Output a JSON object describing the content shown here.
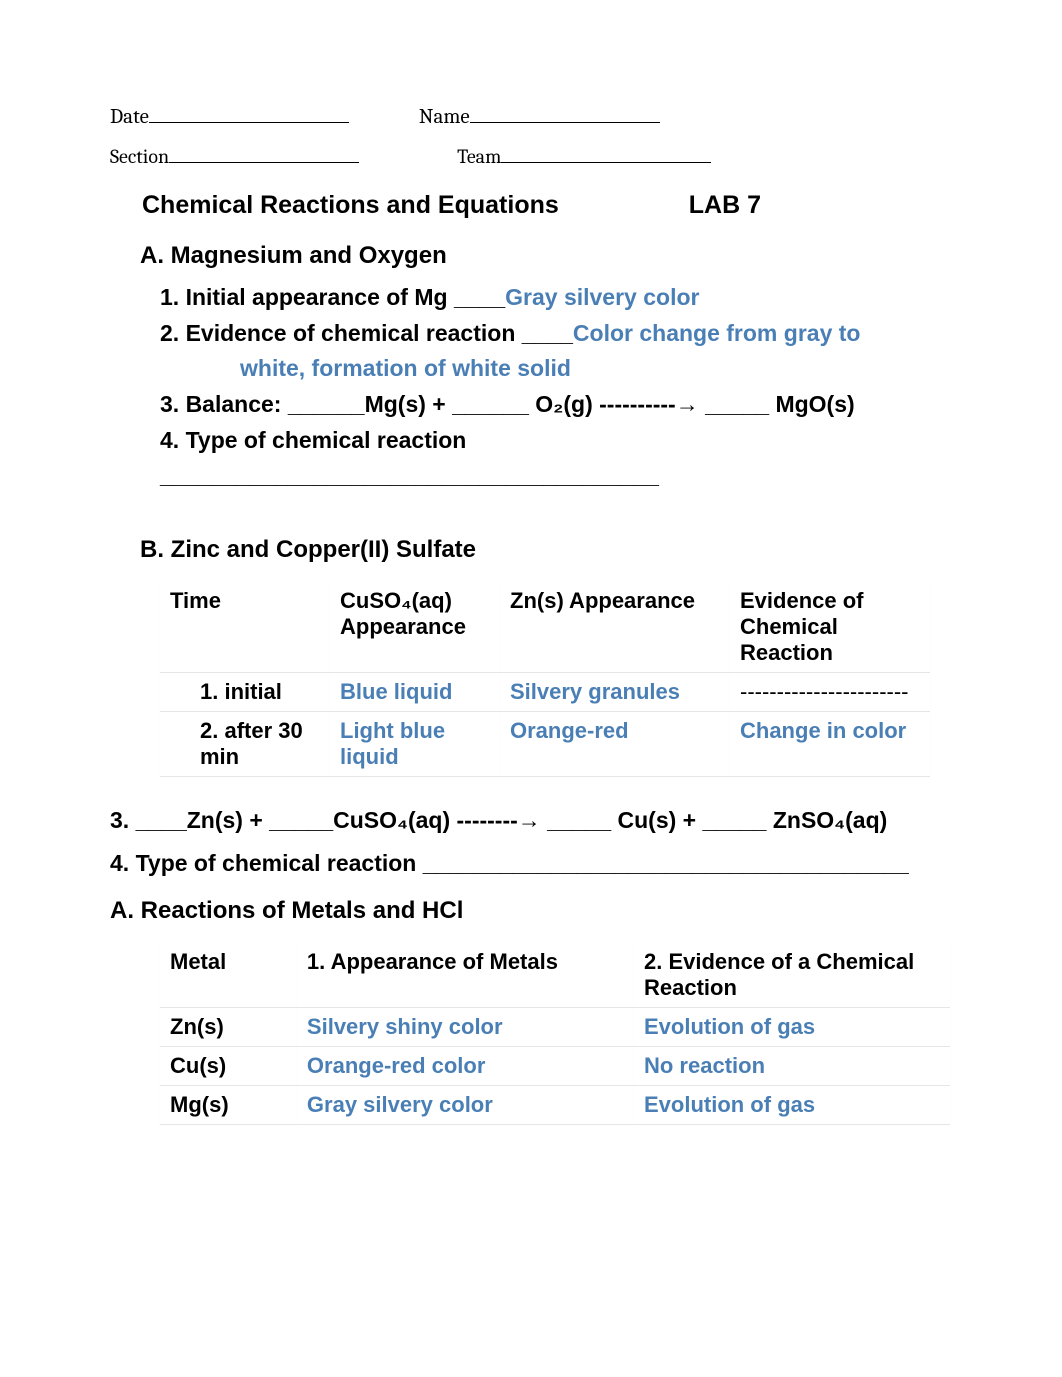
{
  "header": {
    "date_label": "Date",
    "name_label": "Name",
    "section_label": "Section",
    "team_label": "Team"
  },
  "title": {
    "main": "Chemical Reactions and Equations",
    "lab": "LAB 7"
  },
  "sectionA": {
    "heading": "A. Magnesium and Oxygen",
    "q1_label": "1.  Initial appearance of Mg   ____",
    "q1_answer": "Gray silvery color",
    "q2_label": "2.  Evidence of chemical reaction ____",
    "q2_answer": "Color change from gray to",
    "q2_answer_line2": "white, formation of white solid",
    "q3": "3.  Balance:   ______Mg(s) + ______ O₂(g) ----------→ _____ MgO(s)",
    "q4": "4.  Type of chemical reaction _______________________________________"
  },
  "sectionB": {
    "heading": "B. Zinc and Copper(II) Sulfate",
    "headers": {
      "time": "Time",
      "cuso4": "CuSO₄(aq) Appearance",
      "zn": "Zn(s) Appearance",
      "evidence": "Evidence of Chemical Reaction"
    },
    "rows": [
      {
        "time": "1.  initial",
        "cuso4": "Blue liquid",
        "zn": "Silvery granules",
        "evidence": "-----------------------"
      },
      {
        "time": "2.  after 30 min",
        "cuso4": "Light blue liquid",
        "zn": "Orange-red",
        "evidence": "Change in color"
      }
    ],
    "eq": "3. ____Zn(s) + _____CuSO₄(aq) --------→ _____ Cu(s) + _____ ZnSO₄(aq)",
    "type": "4.  Type of chemical reaction ______________________________________"
  },
  "sectionC": {
    "heading": "A. Reactions of Metals and HCl",
    "headers": {
      "metal": "Metal",
      "appearance": "1.  Appearance of Metals",
      "evidence": "2.  Evidence of a Chemical Reaction"
    },
    "rows": [
      {
        "metal": "Zn(s)",
        "appearance": "Silvery shiny color",
        "evidence": "Evolution of gas"
      },
      {
        "metal": "Cu(s)",
        "appearance": "Orange-red color",
        "evidence": "No reaction"
      },
      {
        "metal": "Mg(s)",
        "appearance": "Gray silvery color",
        "evidence": "Evolution of gas"
      }
    ]
  }
}
